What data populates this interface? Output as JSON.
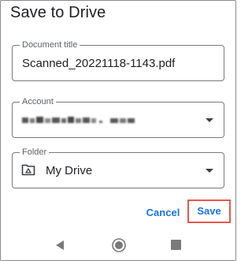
{
  "dialog": {
    "title": "Save to Drive"
  },
  "fields": {
    "document_title": {
      "label": "Document title",
      "value": "Scanned_20221118-1143.pdf"
    },
    "account": {
      "label": "Account",
      "value_hidden": true
    },
    "folder": {
      "label": "Folder",
      "value": "My Drive",
      "icon": "drive-folder-icon"
    }
  },
  "actions": {
    "cancel_label": "Cancel",
    "save_label": "Save"
  },
  "colors": {
    "accent": "#1a73e8",
    "highlight": "#e8574a",
    "outline": "#7a7a7a"
  },
  "nav": {
    "icons": [
      "back-icon",
      "home-icon",
      "recents-icon"
    ]
  }
}
